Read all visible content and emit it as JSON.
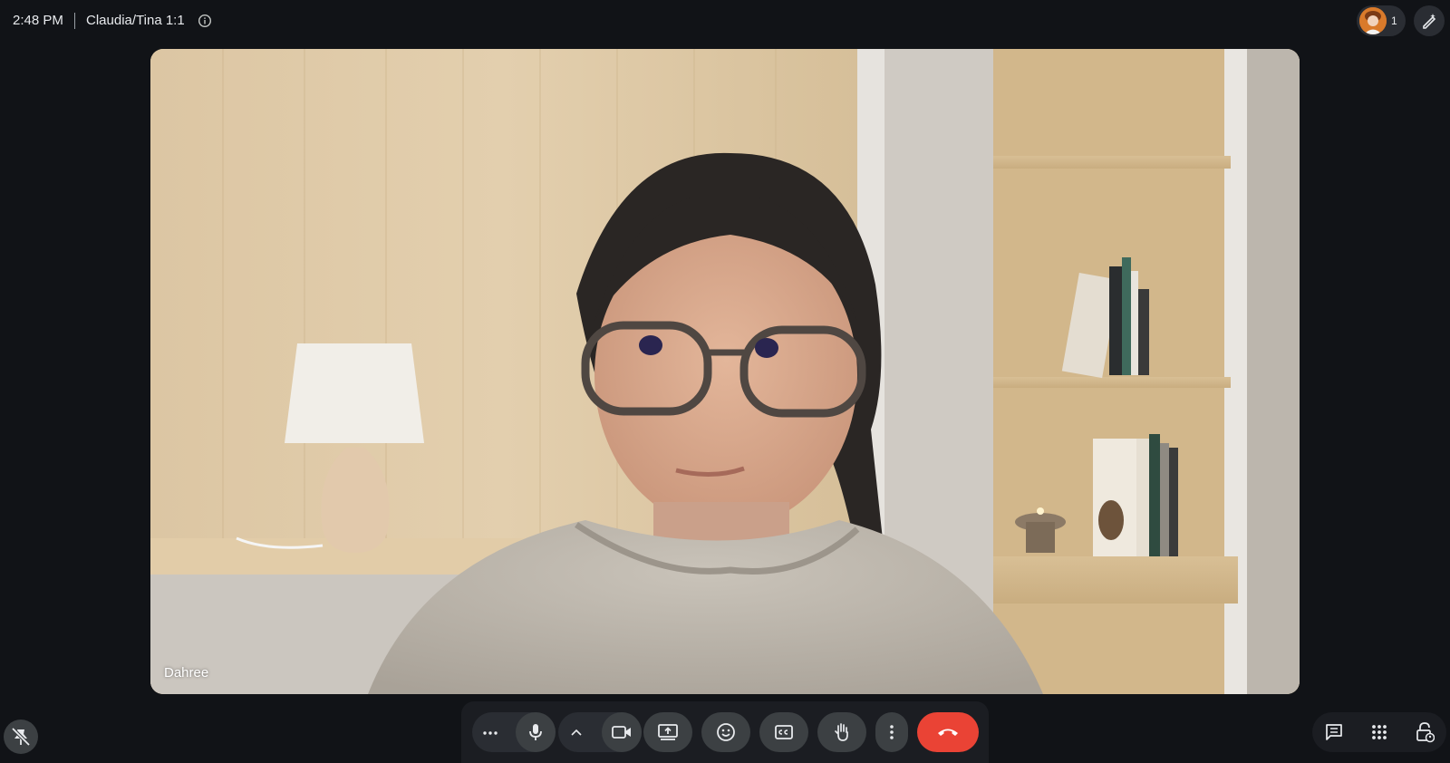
{
  "header": {
    "time": "2:48 PM",
    "meeting_title": "Claudia/Tina 1:1",
    "participant_count": "1"
  },
  "video": {
    "participant_name": "Dahree"
  },
  "icons": {
    "info": "info-icon",
    "magic_pen": "magic-pen-icon",
    "pin_off": "pin-off-icon",
    "more_horiz": "more-horizontal-icon",
    "mic": "microphone-icon",
    "chevron_up": "chevron-up-icon",
    "camera": "video-camera-icon",
    "present": "present-screen-icon",
    "emoji": "emoji-icon",
    "captions": "closed-captions-icon",
    "raise_hand": "raise-hand-icon",
    "more_vert": "more-vertical-icon",
    "end_call": "end-call-icon",
    "chat": "chat-icon",
    "activities": "apps-grid-icon",
    "host_controls": "host-controls-lock-icon"
  },
  "colors": {
    "background": "#111317",
    "control_bg": "#3c4043",
    "end_call": "#ea4335"
  }
}
